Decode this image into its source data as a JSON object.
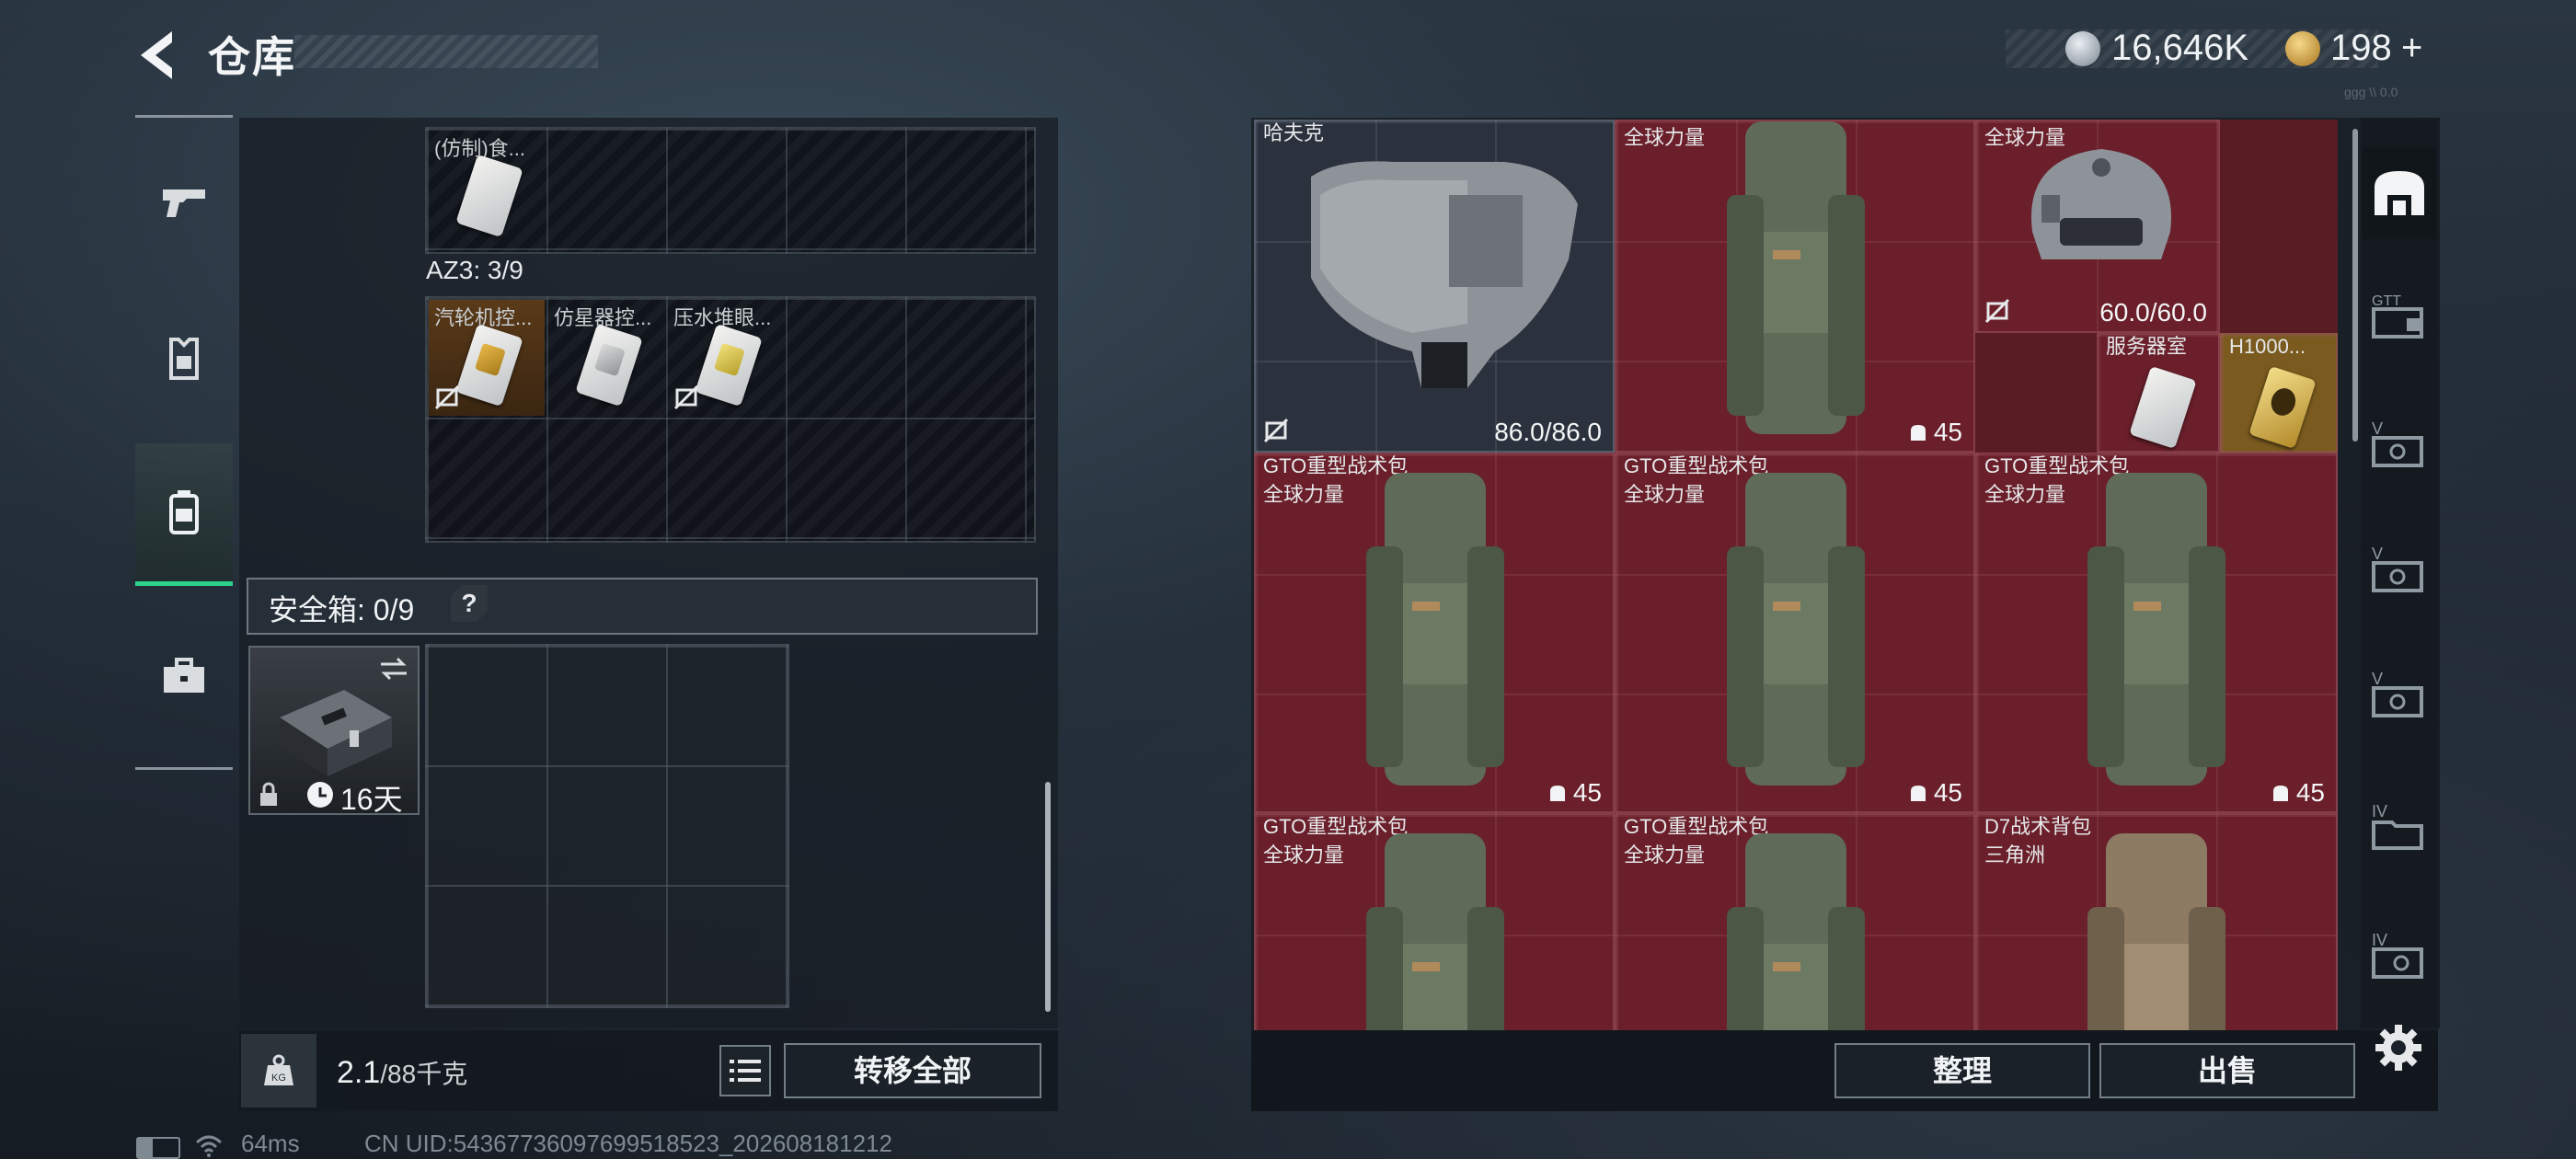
{
  "header": {
    "title": "仓库",
    "currency": [
      {
        "icon": "silver-coin-icon",
        "value": "16,646K"
      },
      {
        "icon": "gold-coin-icon",
        "value": "198"
      }
    ],
    "add_label": "+",
    "version": "ggg \\\\ 0.0"
  },
  "left_nav": [
    {
      "icon": "pistol-icon"
    },
    {
      "icon": "armor-rig-icon"
    },
    {
      "icon": "backpack-icon",
      "active": true
    },
    {
      "icon": "briefcase-icon"
    }
  ],
  "left_panel": {
    "top_grid_items": [
      {
        "label": "(仿制)食..."
      }
    ],
    "az3_label": "AZ3: 3/9",
    "az3_items": [
      {
        "label": "汽轮机控..."
      },
      {
        "label": "仿星器控..."
      },
      {
        "label": "压水堆眼..."
      }
    ],
    "safe_box_label": "安全箱: 0/9",
    "help_label": "?",
    "safe_box_timer": "16天",
    "footer": {
      "weight_value": "2.1",
      "weight_capacity": "/88千克",
      "transfer_all_label": "转移全部"
    }
  },
  "stash": {
    "items": [
      {
        "id": "vest",
        "name": "哈夫克",
        "sub": "",
        "value": "86.0/86.0",
        "color": "gray"
      },
      {
        "id": "bp1",
        "name": "",
        "sub": "全球力量",
        "value": "45",
        "color": "red"
      },
      {
        "id": "helmet",
        "name": "",
        "sub": "全球力量",
        "value": "60.0/60.0",
        "color": "red"
      },
      {
        "id": "card1",
        "name": "服务器室",
        "sub": "",
        "value": "",
        "color": "red"
      },
      {
        "id": "card2",
        "name": "H1000...",
        "sub": "",
        "value": "",
        "color": "gold"
      },
      {
        "id": "bp2",
        "name": "GTO重型战术包",
        "sub": "全球力量",
        "value": "45",
        "color": "red"
      },
      {
        "id": "bp3",
        "name": "GTO重型战术包",
        "sub": "全球力量",
        "value": "45",
        "color": "red"
      },
      {
        "id": "bp4",
        "name": "GTO重型战术包",
        "sub": "全球力量",
        "value": "45",
        "color": "red"
      },
      {
        "id": "bp5",
        "name": "GTO重型战术包",
        "sub": "全球力量",
        "value": "",
        "color": "red"
      },
      {
        "id": "bp6",
        "name": "GTO重型战术包",
        "sub": "全球力量",
        "value": "",
        "color": "red"
      },
      {
        "id": "bp7",
        "name": "D7战术背包",
        "sub": "三角洲",
        "value": "",
        "color": "red"
      }
    ],
    "footer": {
      "organize_label": "整理",
      "sell_label": "出售"
    }
  },
  "right_tabs": [
    {
      "icon": "stash-icon",
      "active": true
    },
    {
      "icon": "expansion-box-gtt-icon"
    },
    {
      "icon": "expansion-box-v-icon"
    },
    {
      "icon": "expansion-box-v-icon"
    },
    {
      "icon": "expansion-box-v-icon"
    },
    {
      "icon": "expansion-box-iv-icon"
    },
    {
      "icon": "expansion-box-iv-icon"
    }
  ],
  "settings_icon": "gear-icon",
  "status_bar": {
    "ping": "64ms",
    "uid": "CN UID:54367736097699518523_202608181212"
  }
}
